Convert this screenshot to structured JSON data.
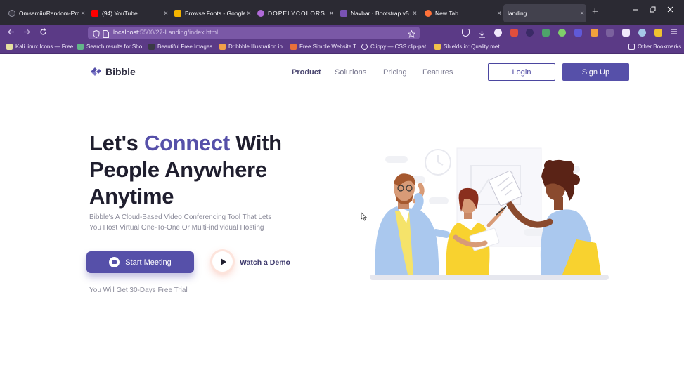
{
  "browser": {
    "tabs": [
      {
        "label": "Omsamiir/Random-Proje",
        "icon": "github-icon",
        "color": "#2b2a33"
      },
      {
        "label": "(94) YouTube",
        "icon": "youtube-icon",
        "color": "#ff0000"
      },
      {
        "label": "Browse Fonts - Google F",
        "icon": "google-fonts-icon",
        "color": "#f4b400"
      },
      {
        "label": "DOPELYCOLORS |",
        "icon": "dopely-icon",
        "color": "#b06ad8"
      },
      {
        "label": "Navbar · Bootstrap v5.1",
        "icon": "bootstrap-icon",
        "color": "#7952b3"
      },
      {
        "label": "New Tab",
        "icon": "firefox-icon",
        "color": "#ff7139"
      },
      {
        "label": "landing",
        "icon": "",
        "color": ""
      }
    ],
    "close_glyph": "×",
    "new_tab_glyph": "+",
    "url": {
      "host": "localhost",
      "path": ":5500/27-Landing/index.html"
    },
    "bookmarks": [
      "Kali linux Icons — Free ...",
      "Search results for Sho...",
      "Beautiful Free Images ...",
      "Dribbble Illustration in...",
      "Free Simple Website T...",
      "Clippy — CSS clip-pat...",
      "Shields.io: Quality met..."
    ],
    "other_bookmarks": "Other Bookmarks"
  },
  "site": {
    "brand": "Bibble",
    "nav": [
      "Product",
      "Solutions",
      "Pricing",
      "Features"
    ],
    "login": "Login",
    "signup": "Sign Up"
  },
  "hero": {
    "title_part1": "Let's ",
    "title_accent": "Connect",
    "title_part2": " With",
    "title_line2": "People Anywhere",
    "title_line3": "Anytime",
    "subtitle": "Bibble's A Cloud-Based Video Conferencing Tool That Lets You Host Virtual One-To-One Or Multi-individual Hosting",
    "start_button": "Start Meeting",
    "watch_demo": "Watch a Demo",
    "trial_note": "You Will Get 30-Days Free Trial"
  },
  "colors": {
    "brand": "#5650a9",
    "title": "#1f1e2e",
    "muted": "#8a8a99",
    "chrome_dark": "#2b2a33",
    "chrome_purple": "#5b3a86"
  }
}
